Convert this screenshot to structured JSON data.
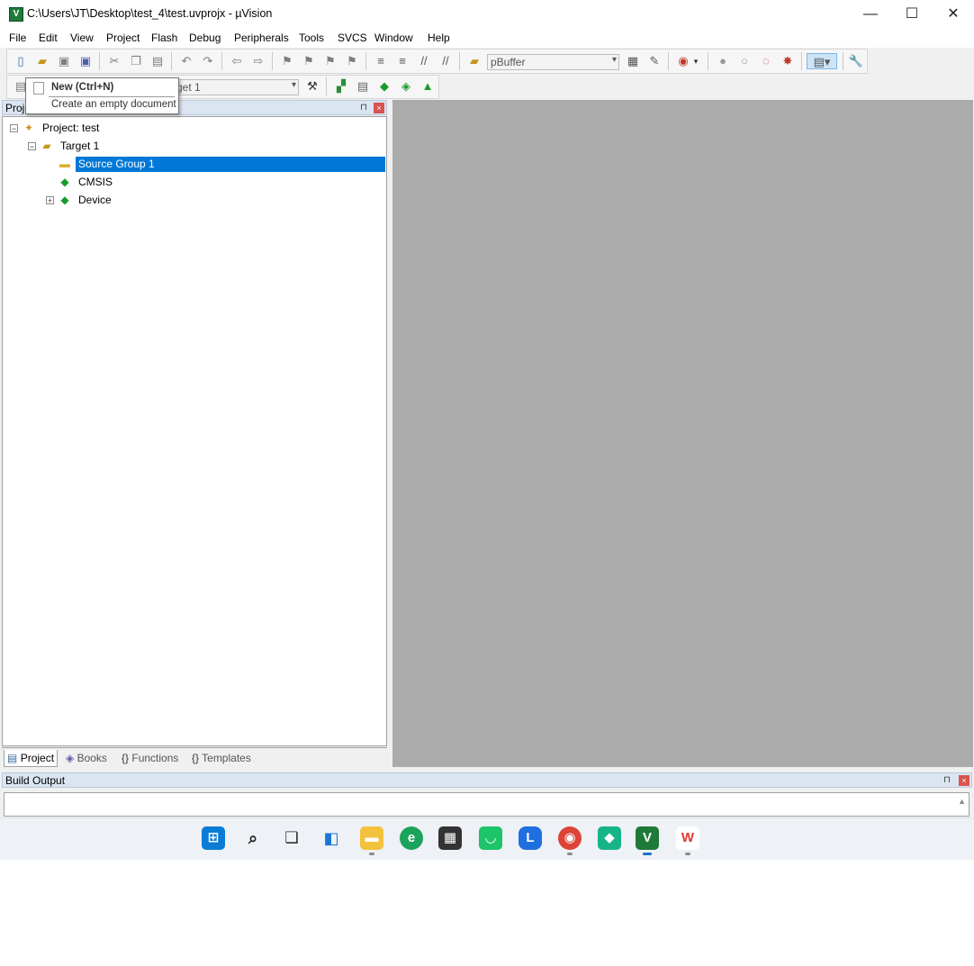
{
  "window": {
    "title": "C:\\Users\\JT\\Desktop\\test_4\\test.uvprojx - µVision",
    "controls": {
      "minimize": "—",
      "maximize": "☐",
      "close": "✕"
    }
  },
  "menu": [
    "File",
    "Edit",
    "View",
    "Project",
    "Flash",
    "Debug",
    "Peripherals",
    "Tools",
    "SVCS",
    "Window",
    "Help"
  ],
  "toolbar": {
    "find_value": "pBuffer",
    "target_value": "rget 1",
    "icons": [
      "new-file-icon",
      "open-folder-icon",
      "save-icon",
      "save-all-icon",
      "cut-icon",
      "copy-icon",
      "paste-icon",
      "undo-icon",
      "redo-icon",
      "nav-back-icon",
      "nav-forward-icon",
      "bookmark-icon",
      "prev-bookmark-icon",
      "next-bookmark-icon",
      "clear-bookmarks-icon",
      "indent-icon",
      "unindent-icon",
      "comment-icon",
      "uncomment-icon",
      "find-in-files-icon",
      "find-icon",
      "incremental-find-icon",
      "debug-icon",
      "breakpoint-insert-icon",
      "breakpoint-enable-icon",
      "breakpoint-disable-icon",
      "breakpoint-kill-icon",
      "window-layout-icon",
      "configure-icon"
    ]
  },
  "tooltip": {
    "title": "New (Ctrl+N)",
    "description": "Create an empty document"
  },
  "project_panel": {
    "header": "Proje",
    "pin": "⊓",
    "close": "×",
    "tree": [
      {
        "label": "Project: test",
        "level": 0,
        "expander": "−",
        "icon": "project-icon"
      },
      {
        "label": "Target 1",
        "level": 1,
        "expander": "−",
        "icon": "target-folder-icon"
      },
      {
        "label": "Source Group 1",
        "level": 2,
        "expander": "",
        "icon": "folder-icon",
        "selected": true
      },
      {
        "label": "CMSIS",
        "level": 2,
        "expander": "",
        "icon": "cmsis-diamond-icon"
      },
      {
        "label": "Device",
        "level": 2,
        "expander": "+",
        "icon": "device-diamond-icon"
      }
    ],
    "tabs": [
      "Project",
      "Books",
      "Functions",
      "Templates"
    ]
  },
  "build_output": {
    "title": "Build Output",
    "scroll_up": "▲"
  },
  "colors": {
    "selection": "#0078d7",
    "editor_bg": "#ababab",
    "panel_header": "#dbe5f1"
  }
}
